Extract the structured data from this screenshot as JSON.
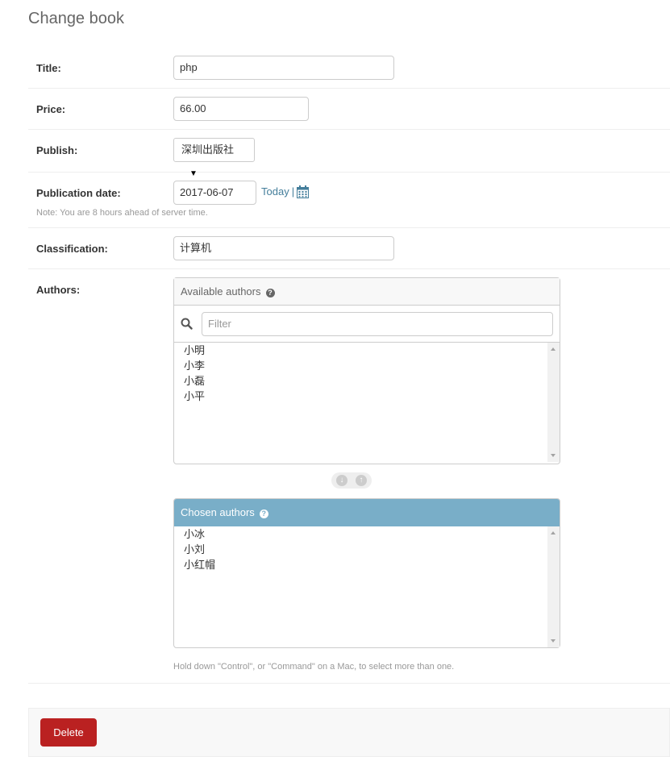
{
  "page": {
    "title": "Change book"
  },
  "fields": {
    "title": {
      "label": "Title:",
      "value": "php"
    },
    "price": {
      "label": "Price:",
      "value": "66.00"
    },
    "publish": {
      "label": "Publish:",
      "value": "深圳出版社"
    },
    "publication_date": {
      "label": "Publication date:",
      "value": "2017-06-07",
      "today_label": "Today",
      "separator": "|",
      "note": "Note: You are 8 hours ahead of server time."
    },
    "classification": {
      "label": "Classification:",
      "value": "计算机"
    },
    "authors": {
      "label": "Authors:",
      "available_title": "Available authors",
      "filter_placeholder": "Filter",
      "available": [
        "小明",
        "小李",
        "小磊",
        "小平"
      ],
      "chosen_title": "Chosen authors",
      "chosen": [
        "小冰",
        "小刘",
        "小红帽"
      ],
      "help": "Hold down \"Control\", or \"Command\" on a Mac, to select more than one."
    }
  },
  "actions": {
    "delete_label": "Delete"
  },
  "icons": {
    "help": "question-circle-icon",
    "calendar": "calendar-icon",
    "search": "search-icon",
    "add": "arrow-down-circle-icon",
    "remove": "arrow-up-circle-icon"
  },
  "colors": {
    "link": "#447e9b",
    "chosen_header": "#79aec8",
    "delete": "#ba2121"
  }
}
